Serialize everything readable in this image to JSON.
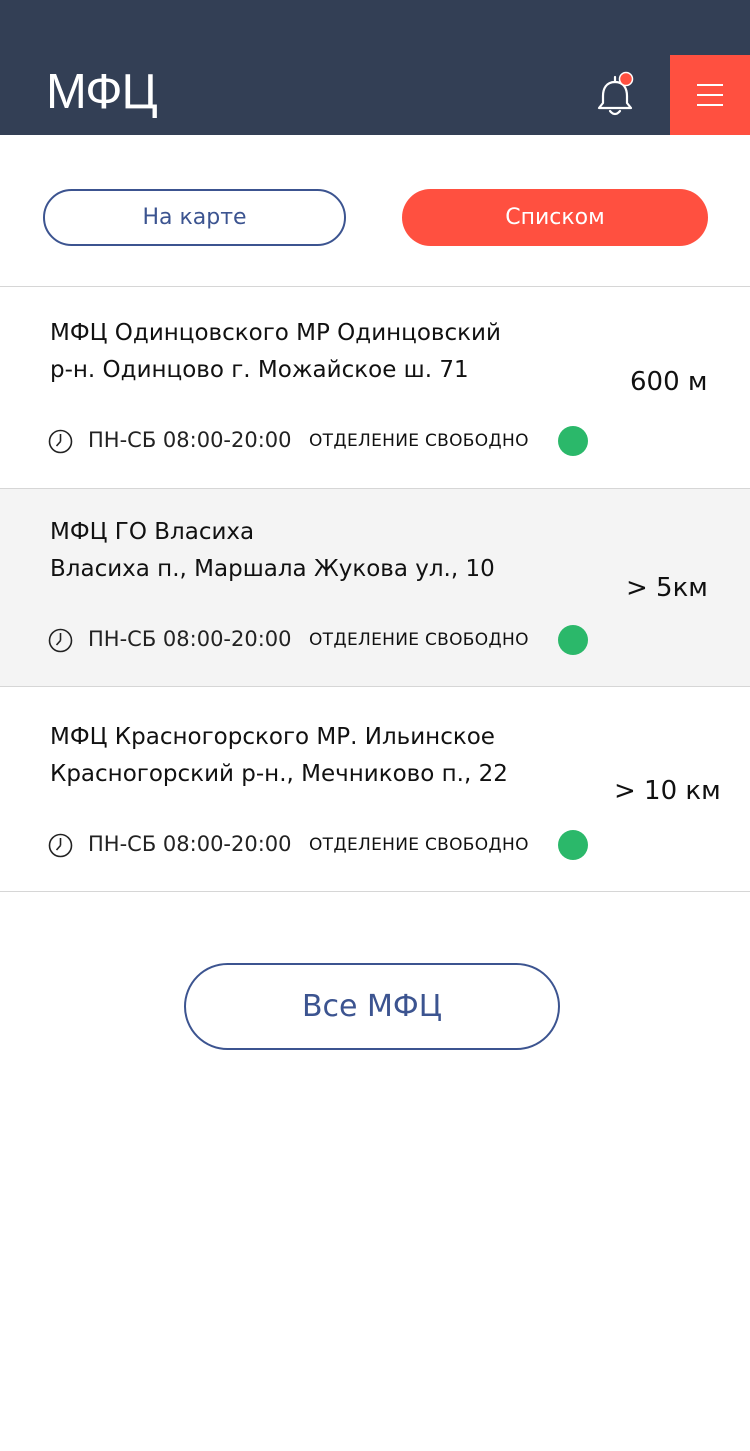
{
  "header": {
    "title": "МФЦ",
    "bell_icon": "bell-icon",
    "menu_icon": "hamburger-menu-icon",
    "accent_color": "#ff5040",
    "bar_color": "#333f55"
  },
  "view_toggle": {
    "map_label": "На карте",
    "list_label": "Списком",
    "active": "Списком"
  },
  "offices": [
    {
      "name": "МФЦ Одинцовского МР Одинцовский\nр-н. Одинцово г. Можайское ш. 71",
      "distance": "600 м",
      "hours": "ПН-СБ 08:00-20:00",
      "status": "ОТДЕЛЕНИЕ СВОБОДНО",
      "status_color": "#2bb86a"
    },
    {
      "name": "МФЦ ГО Власиха\nВласиха п., Маршала Жукова ул., 10",
      "distance": "> 5км",
      "hours": "ПН-СБ 08:00-20:00",
      "status": "ОТДЕЛЕНИЕ СВОБОДНО",
      "status_color": "#2bb86a"
    },
    {
      "name": "МФЦ Красногорского МР. Ильинское\nКрасногорский р-н., Мечниково п., 22",
      "distance": "> 10 км",
      "hours": "ПН-СБ 08:00-20:00",
      "status": "ОТДЕЛЕНИЕ СВОБОДНО",
      "status_color": "#2bb86a"
    }
  ],
  "all_button_label": "Все МФЦ"
}
